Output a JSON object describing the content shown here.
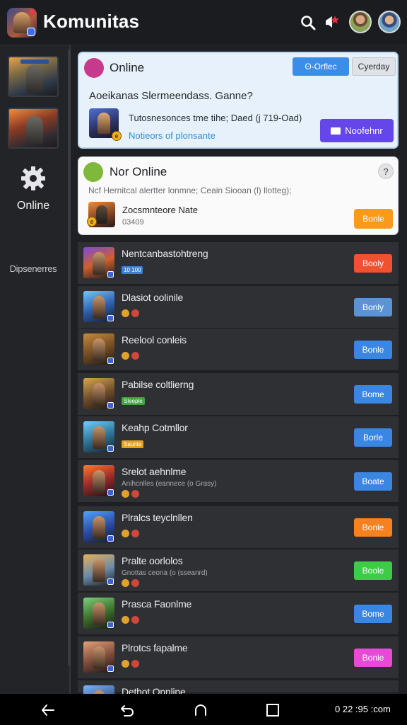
{
  "header": {
    "title": "Komunitas",
    "icons": [
      "search-icon",
      "notification-icon"
    ]
  },
  "sidebar": {
    "online_label": "Online",
    "dispensers_label": "Dipsenerres"
  },
  "online_card": {
    "title": "Online",
    "filter_button": "ʘ-Orflec",
    "today_button": "Cyerday",
    "question": "Aoeikanas Slermeendass. Ganne?",
    "description": "Tutosnesonces tme tihe; Daed (j 719-Oad)",
    "link": "Notieors of plonsante",
    "notify_button": "Noofehnr"
  },
  "not_online_card": {
    "title": "Nor Online",
    "note": "Ncf Hernitcal alertter lonmne; Ceain Siooan (l) llotteg);",
    "game_name": "Zocsmnteore Nate",
    "game_sub": "03409",
    "button": "Bonle"
  },
  "list": [
    {
      "name": "Nentcanbastohtreng",
      "tag": "10 100",
      "tag_color": "#3b82d6",
      "button": "Booly",
      "btn_color": "#f0522f"
    },
    {
      "name": "Dlasiot oolinile",
      "button": "Bonly",
      "btn_color": "#5b94d6"
    },
    {
      "name": "Reelool conleis",
      "button": "Bonle",
      "btn_color": "#3a86e3"
    },
    {
      "name": "Pabilse coltlierng",
      "tag": "Sleeple",
      "tag_color": "#3aa83c",
      "button": "Bome",
      "btn_color": "#3a86e3"
    },
    {
      "name": "Keahp Cotmllor",
      "tag": "Saunte",
      "tag_color": "#e7a21a",
      "button": "Borle",
      "btn_color": "#3a86e3"
    },
    {
      "name": "Srelot aehnlme",
      "sub": "Anihcnlles (eannece (o Grasy)",
      "button": "Boate",
      "btn_color": "#3a86e3"
    },
    {
      "name": "Plralcs teyclnllen",
      "button": "Bonle",
      "btn_color": "#f5811f"
    },
    {
      "name": "Pralte oorlolos",
      "sub": "Gnottas ceona (o (sseanrd)",
      "button": "Boole",
      "btn_color": "#3ccc45"
    },
    {
      "name": "Prasca Faonlme",
      "button": "Bome",
      "btn_color": "#3a86e3"
    },
    {
      "name": "Plrotcs fapalme",
      "button": "Bonle",
      "btn_color": "#e84ad8"
    },
    {
      "name": "Dethot Onnline",
      "button": "",
      "btn_color": "#3a86e3"
    }
  ],
  "navbar": {
    "time": "0 22 :95 :com"
  }
}
